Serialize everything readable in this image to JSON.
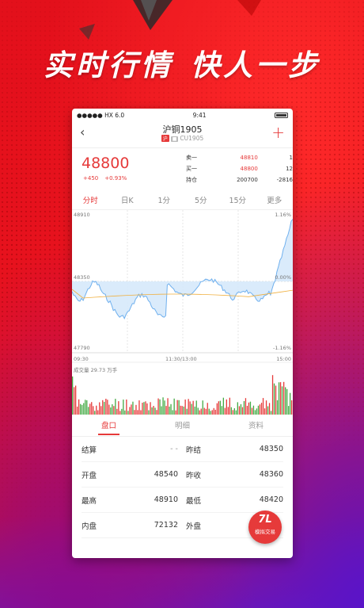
{
  "banner": {
    "left": "实时行情",
    "right": "快人一步"
  },
  "status_bar": {
    "carrier": "●●●●● HX 6.0",
    "time": "9:41"
  },
  "nav": {
    "back": "‹",
    "title": "沪铜1905",
    "badge1": "沪",
    "badge2": "■",
    "code": "CU1905",
    "plus": "+"
  },
  "quote": {
    "price": "48800",
    "change": "+450",
    "change_pct": "+0.93%",
    "rows": [
      {
        "label": "卖一",
        "price": "48810",
        "qty": "1"
      },
      {
        "label": "买一",
        "price": "48800",
        "qty": "12"
      },
      {
        "label": "持仓",
        "price": "200700",
        "qty": "-2816"
      }
    ]
  },
  "tabs": [
    "分时",
    "日K",
    "1分",
    "5分",
    "15分",
    "更多"
  ],
  "chart": {
    "y_top": "48910",
    "y_mid": "48350",
    "y_bot": "47790",
    "pct_top": "1.16%",
    "pct_mid": "0.00%",
    "pct_bot": "-1.16%",
    "t_start": "09:30",
    "t_mid": "11:30/13:00",
    "t_end": "15:00",
    "volume_label": "成交量 29.73 万手"
  },
  "bottom_tabs": [
    "盘口",
    "明细",
    "资料"
  ],
  "stats": [
    {
      "k": "结算",
      "v": "- -",
      "k2": "昨结",
      "v2": "48350"
    },
    {
      "k": "开盘",
      "v": "48540",
      "k2": "昨收",
      "v2": "48360"
    },
    {
      "k": "最高",
      "v": "48910",
      "k2": "最低",
      "v2": "48420"
    },
    {
      "k": "内盘",
      "v": "72132",
      "k2": "外盘",
      "v2": ""
    }
  ],
  "fab": {
    "icon": "7L",
    "label": "模拟交易"
  },
  "colors": {
    "red": "#e63a3a",
    "green": "#44aa44",
    "line": "#6fb0ee",
    "avg": "#f0b040"
  }
}
